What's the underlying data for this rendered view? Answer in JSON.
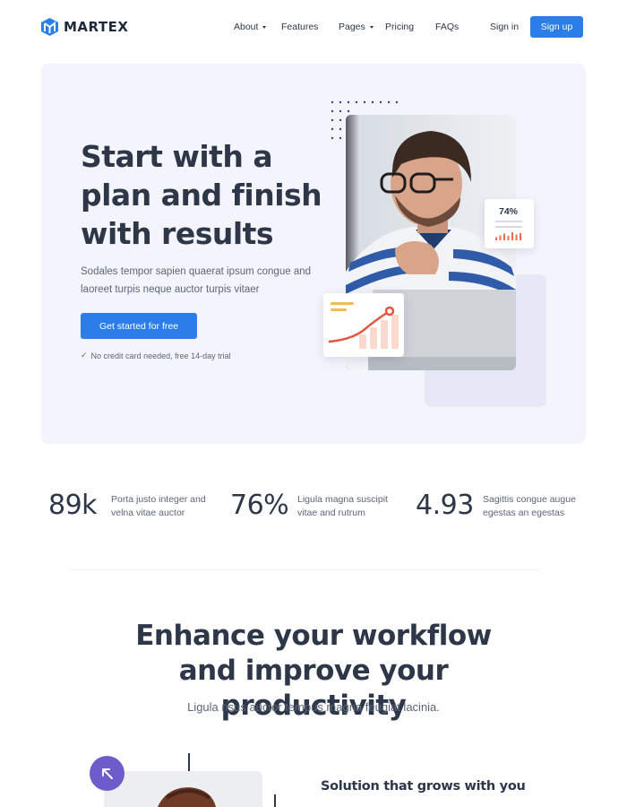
{
  "brand": {
    "name": "MARTEX",
    "color": "#2b7de9"
  },
  "nav": {
    "items": [
      {
        "label": "About",
        "dropdown": true
      },
      {
        "label": "Features",
        "dropdown": false
      },
      {
        "label": "Pages",
        "dropdown": true
      },
      {
        "label": "Pricing",
        "dropdown": false
      },
      {
        "label": "FAQs",
        "dropdown": false
      }
    ],
    "signin_label": "Sign in",
    "signup_label": "Sign up"
  },
  "hero": {
    "title": "Start with a plan and finish with results",
    "description": "Sodales tempor sapien quaerat ipsum congue and laoreet turpis neque auctor turpis vitaer",
    "cta_label": "Get started for free",
    "note": "No credit card needed, free 14-day trial",
    "stat_card_value": "74%",
    "bar_heights": [
      0.35,
      0.55,
      0.75,
      0.5,
      0.9,
      0.65,
      0.8
    ],
    "colors": {
      "background": "#f4f4fc",
      "accent_orange": "#f36b4f",
      "accent_yellow": "#f7b955"
    }
  },
  "stats": [
    {
      "value": "89k",
      "text": "Porta justo integer and velna vitae auctor"
    },
    {
      "value": "76%",
      "text": "Ligula magna suscipit vitae and rutrum"
    },
    {
      "value": "4.93",
      "text": "Sagittis congue augue egestas an egestas"
    }
  ],
  "section": {
    "title": "Enhance your workflow and improve your productivity",
    "subtitle": "Ligula risus auctor tempus magna feugiat lacinia.",
    "feature_title": "Solution that grows with you",
    "icon_button_color": "#6f5ccb"
  }
}
